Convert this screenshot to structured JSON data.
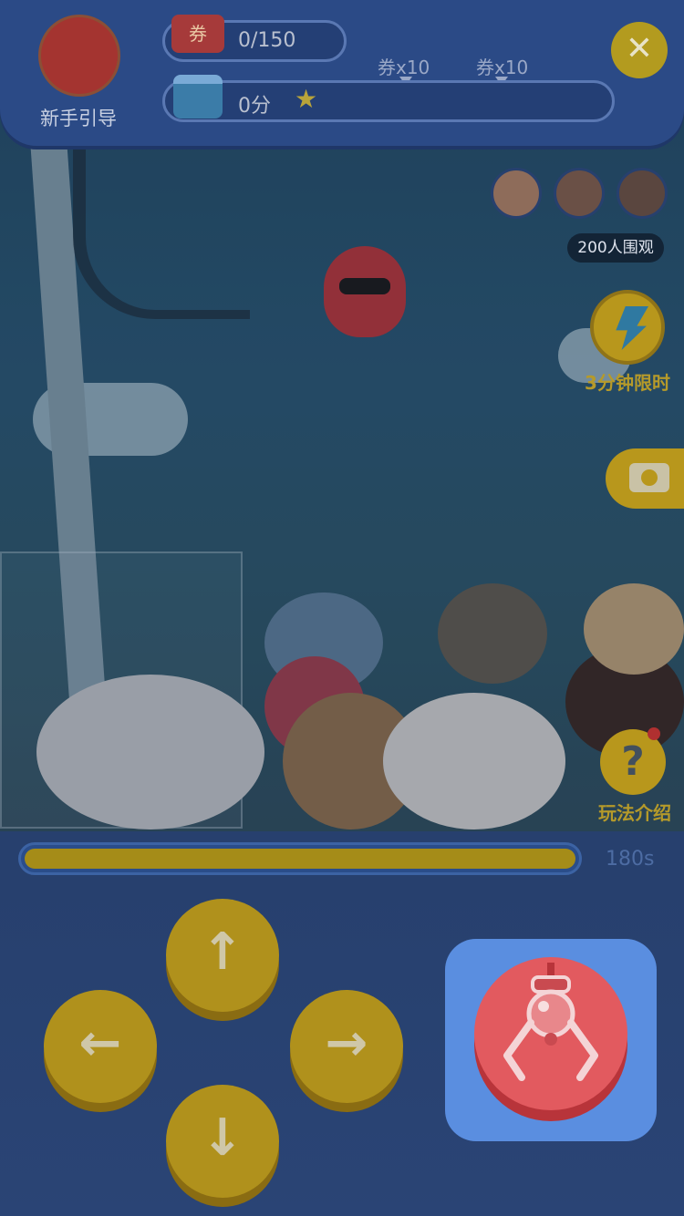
{
  "header": {
    "guide_label": "新手引导",
    "ticket_icon_text": "券",
    "ticket_progress": "0/150",
    "score_text": "0分",
    "milestones": [
      {
        "label": "券x10"
      },
      {
        "label": "券x10"
      }
    ],
    "close_icon": "close-icon"
  },
  "viewers": {
    "count_label": "200人围观"
  },
  "side": {
    "timer_label": "3分钟限时",
    "help_label": "玩法介绍",
    "help_glyph": "?",
    "camera_icon": "camera-icon"
  },
  "timer": {
    "progress": 1.0,
    "label": "180s"
  },
  "controls": {
    "up": "↑",
    "down": "↓",
    "left": "←",
    "right": "→",
    "grab_icon": "claw-icon"
  },
  "colors": {
    "panel": "#2b4a86",
    "button_yellow": "#b0911c",
    "grab_red": "#e25a5f",
    "grab_bg": "#5a8ee0"
  }
}
